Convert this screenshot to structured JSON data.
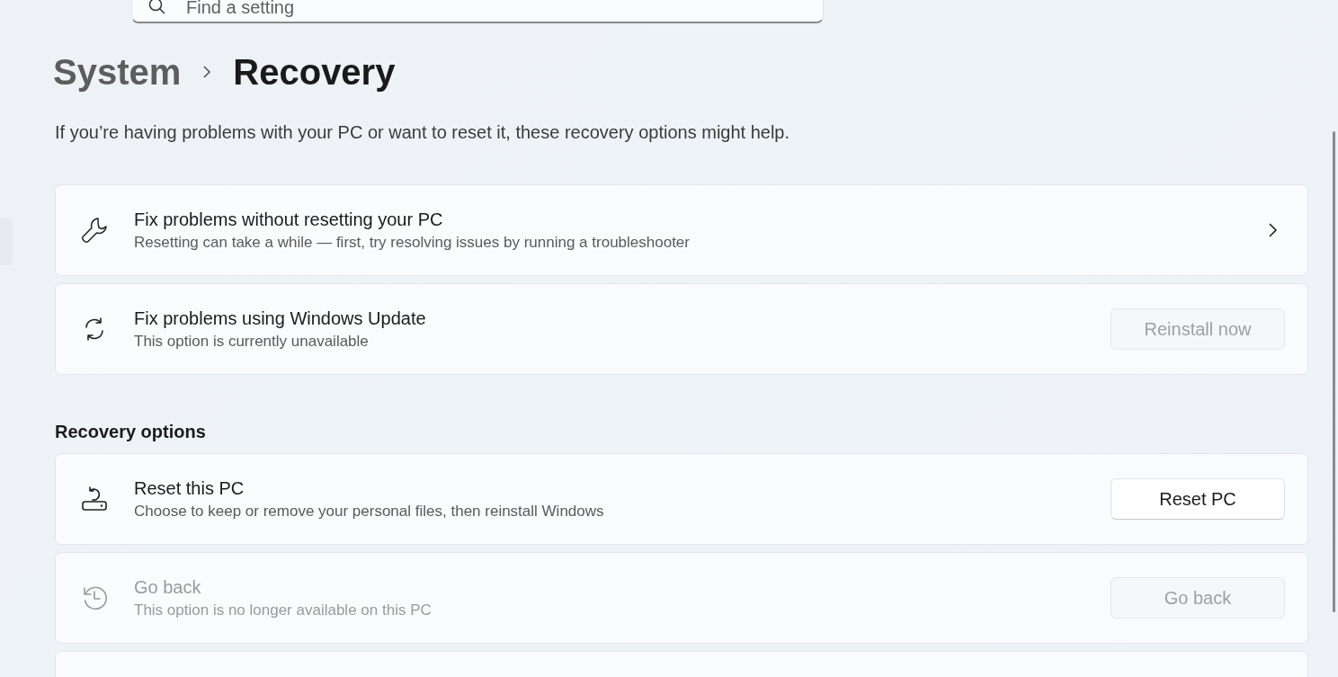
{
  "search": {
    "placeholder": "Find a setting"
  },
  "breadcrumb": {
    "parent": "System",
    "current": "Recovery"
  },
  "description": "If you’re having problems with your PC or want to reset it, these recovery options might help.",
  "cards": [
    {
      "kind": "chevron",
      "title": "Fix problems without resetting your PC",
      "subtitle": "Resetting can take a while — first, try resolving issues by running a troubleshooter",
      "disabled": false
    },
    {
      "kind": "button",
      "title": "Fix problems using Windows Update",
      "subtitle": "This option is currently unavailable",
      "disabled": false,
      "button": {
        "label": "Reinstall now",
        "disabled": true
      }
    }
  ],
  "recovery_options": {
    "heading": "Recovery options",
    "cards": [
      {
        "kind": "button",
        "title": "Reset this PC",
        "subtitle": "Choose to keep or remove your personal files, then reinstall Windows",
        "disabled": false,
        "button": {
          "label": "Reset PC",
          "disabled": false
        }
      },
      {
        "kind": "button",
        "title": "Go back",
        "subtitle": "This option is no longer available on this PC",
        "disabled": true,
        "button": {
          "label": "Go back",
          "disabled": true
        }
      }
    ]
  }
}
